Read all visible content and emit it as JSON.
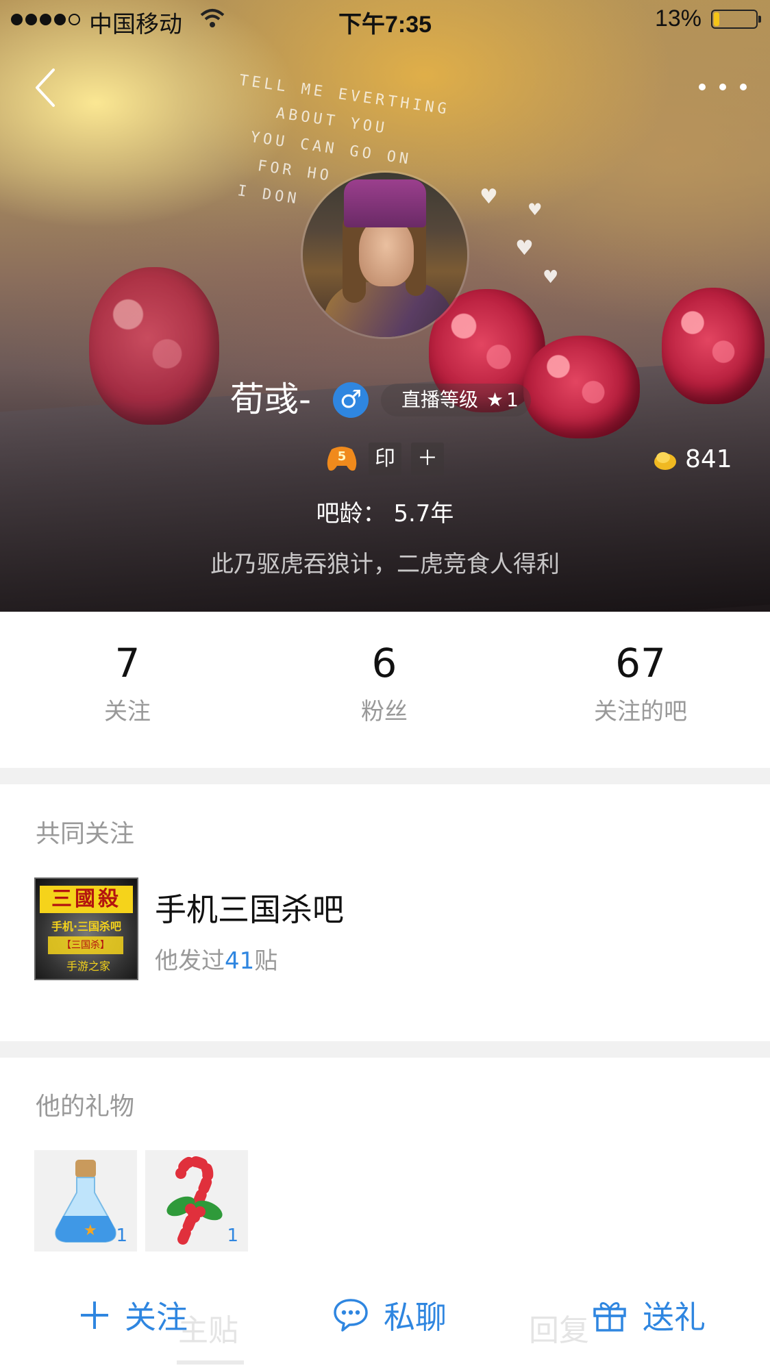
{
  "status_bar": {
    "carrier": "中国移动",
    "time": "下午7:35",
    "battery_percent": "13%",
    "battery_level": 0.13,
    "signal_bars": 4
  },
  "header": {
    "back_icon": "chevron-left-icon",
    "more_icon": "more-dots-icon",
    "background_text": [
      "TELL ME EVERTHING",
      "ABOUT YOU",
      "YOU CAN GO ON",
      "FOR HO",
      "I DON"
    ]
  },
  "profile": {
    "username": "荀彧-",
    "gender_symbol": "♂",
    "live_level_label": "直播等级",
    "live_level_star": "★",
    "live_level_value": "1",
    "game_badge_number": "5",
    "badge_seal": "印",
    "badge_plus": "＋",
    "coins": "841",
    "ba_age": "吧龄：  5.7年",
    "signature": "此乃驱虎吞狼计，二虎竞食人得利"
  },
  "stats": [
    {
      "value": "7",
      "label": "关注"
    },
    {
      "value": "6",
      "label": "粉丝"
    },
    {
      "value": "67",
      "label": "关注的吧"
    }
  ],
  "common_follow": {
    "title": "共同关注",
    "forum": {
      "name": "手机三国杀吧",
      "posts_prefix": "他发过",
      "posts_count": "41",
      "posts_suffix": "贴",
      "thumb_text": [
        "三國殺",
        "手机·三国杀吧",
        "【三国杀】",
        "手游之家"
      ]
    }
  },
  "gifts": {
    "title": "他的礼物",
    "items": [
      {
        "name": "potion-bottle-icon",
        "count": "1"
      },
      {
        "name": "candy-cane-icon",
        "count": "1"
      }
    ]
  },
  "bottom_bar": {
    "ghost_tabs": [
      "主贴",
      "回复"
    ],
    "follow": "关注",
    "chat": "私聊",
    "gift": "送礼"
  },
  "colors": {
    "accent": "#2f86e0",
    "muted_text": "#999999",
    "section_gap": "#f1f1f1"
  }
}
